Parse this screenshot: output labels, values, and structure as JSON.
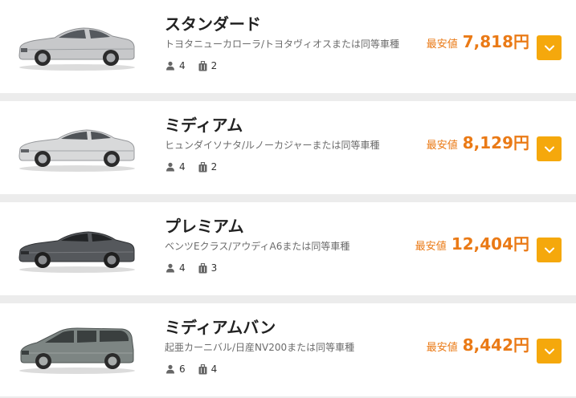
{
  "colors": {
    "price": "#ea7a16",
    "toggle_button": "#f5a80c",
    "card_background": "#ffffff",
    "page_background": "#ececec"
  },
  "cars": [
    {
      "class_name": "スタンダード",
      "models": "トヨタニューカローラ/トヨタヴィオスまたは同等車種",
      "passengers": "4",
      "luggage": "2",
      "price_label": "最安値",
      "price": "7,818円",
      "image_icon": "silver-sedan",
      "toggle_icon": "chevron-down-icon"
    },
    {
      "class_name": "ミディアム",
      "models": "ヒュンダイソナタ/ルノーカジャーまたは同等車種",
      "passengers": "4",
      "luggage": "2",
      "price_label": "最安値",
      "price": "8,129円",
      "image_icon": "silver-sedan",
      "toggle_icon": "chevron-down-icon"
    },
    {
      "class_name": "プレミアム",
      "models": "ベンツEクラス/アウディA6または同等車種",
      "passengers": "4",
      "luggage": "3",
      "price_label": "最安値",
      "price": "12,404円",
      "image_icon": "dark-grey-sedan",
      "toggle_icon": "chevron-down-icon"
    },
    {
      "class_name": "ミディアムバン",
      "models": "起亜カーニバル/日産NV200または同等車種",
      "passengers": "6",
      "luggage": "4",
      "price_label": "最安値",
      "price": "8,442円",
      "image_icon": "grey-minivan",
      "toggle_icon": "chevron-down-icon"
    }
  ]
}
